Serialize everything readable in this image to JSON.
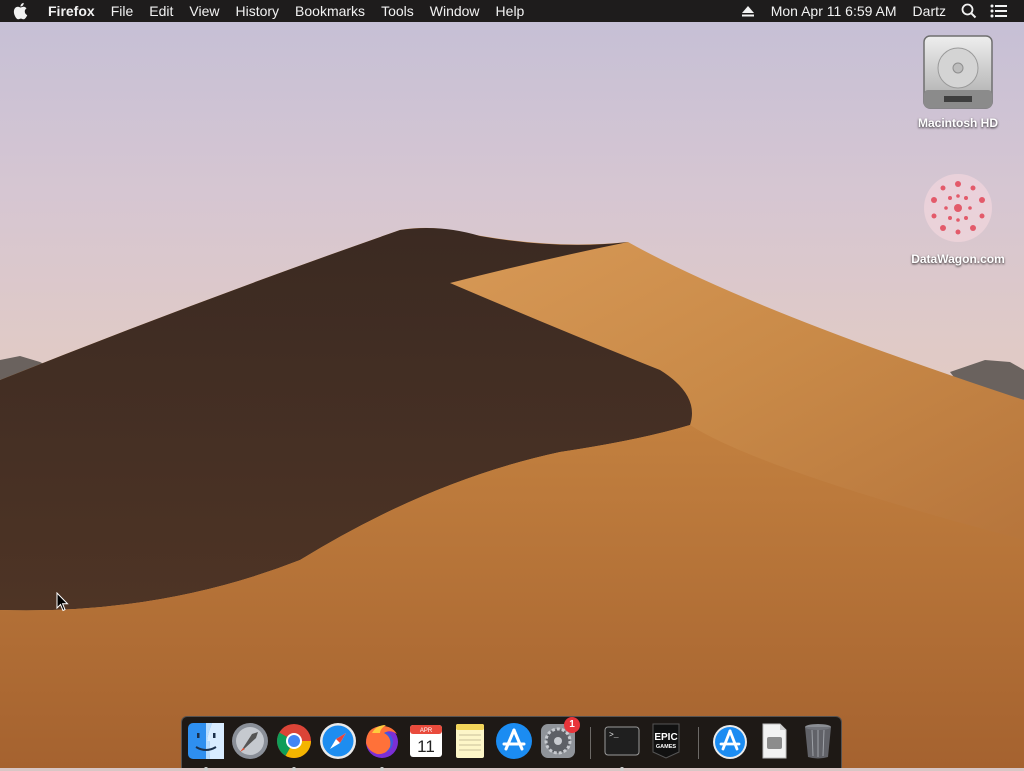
{
  "menubar": {
    "app_name": "Firefox",
    "menus": [
      "File",
      "Edit",
      "View",
      "History",
      "Bookmarks",
      "Tools",
      "Window",
      "Help"
    ],
    "datetime": "Mon Apr 11  6:59 AM",
    "user": "Dartz"
  },
  "desktop_icons": [
    {
      "label": "Macintosh HD",
      "icon": "hard-drive-icon"
    },
    {
      "label": "DataWagon.com",
      "icon": "datawagon-disk-icon"
    }
  ],
  "dock": {
    "items": [
      {
        "name": "finder",
        "icon": "finder-icon",
        "running": true
      },
      {
        "name": "launchpad",
        "icon": "launchpad-icon",
        "running": false
      },
      {
        "name": "chrome",
        "icon": "chrome-icon",
        "running": true
      },
      {
        "name": "safari",
        "icon": "safari-icon",
        "running": false
      },
      {
        "name": "firefox",
        "icon": "firefox-icon",
        "running": true
      },
      {
        "name": "calendar",
        "icon": "calendar-icon",
        "running": false
      },
      {
        "name": "notes",
        "icon": "notes-icon",
        "running": false
      },
      {
        "name": "app-store",
        "icon": "app-store-icon",
        "running": false
      },
      {
        "name": "system-preferences",
        "icon": "gear-icon",
        "running": false
      },
      {
        "name": "terminal",
        "icon": "terminal-icon",
        "running": true
      },
      {
        "name": "epic-games",
        "icon": "epic-games-icon",
        "running": false
      },
      {
        "name": "app-store-downloads",
        "icon": "app-store-folder-icon",
        "running": false
      },
      {
        "name": "document",
        "icon": "document-icon",
        "running": false
      },
      {
        "name": "trash",
        "icon": "trash-icon",
        "running": false
      }
    ],
    "calendar_month": "APR",
    "calendar_day": "11",
    "sys_prefs_badge": "1",
    "terminal_prompt": ">_",
    "epic_line1": "EPIC",
    "epic_line2": "GAMES"
  }
}
